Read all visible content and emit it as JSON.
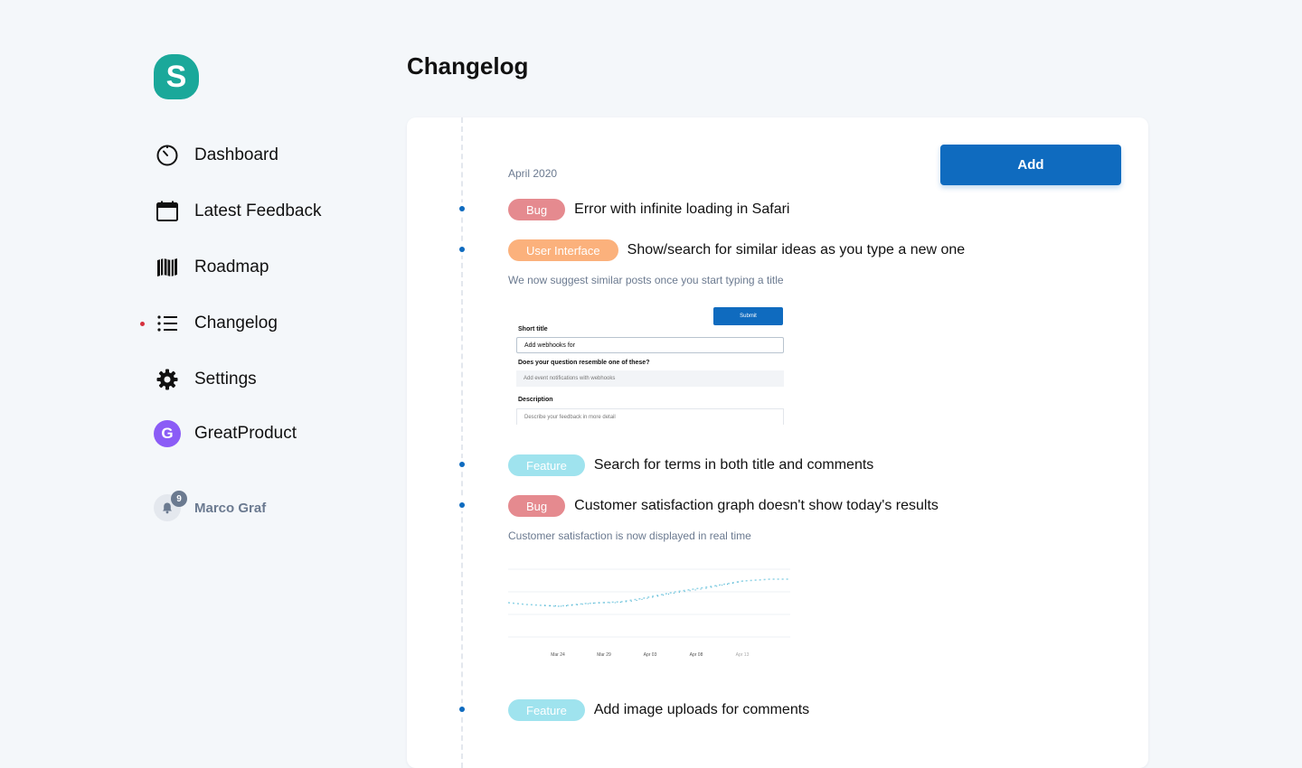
{
  "sidebar": {
    "logo_letter": "S",
    "items": [
      {
        "label": "Dashboard",
        "icon": "timer-icon"
      },
      {
        "label": "Latest Feedback",
        "icon": "calendar-icon"
      },
      {
        "label": "Roadmap",
        "icon": "map-icon"
      },
      {
        "label": "Changelog",
        "icon": "list-icon",
        "active": true
      },
      {
        "label": "Settings",
        "icon": "gear-icon"
      }
    ],
    "product": {
      "label": "GreatProduct",
      "initial": "G",
      "color": "#8b5cf6"
    },
    "user": {
      "name": "Marco Graf",
      "notifications": "9"
    }
  },
  "main": {
    "title": "Changelog",
    "add_label": "Add",
    "month": "April 2020",
    "entries": [
      {
        "tag": "Bug",
        "title": "Error with infinite loading in Safari"
      },
      {
        "tag": "User Interface",
        "title": "Show/search for similar ideas as you type a new one",
        "description": "We now suggest similar posts once you start typing a title"
      },
      {
        "tag": "Feature",
        "title": "Search for terms in both title and comments"
      },
      {
        "tag": "Bug",
        "title": "Customer satisfaction graph doesn't show today's results",
        "description": "Customer satisfaction is now displayed in real time"
      },
      {
        "tag": "Feature",
        "title": "Add image uploads for comments"
      }
    ],
    "preview_form": {
      "submit": "Submit",
      "short_title_label": "Short title",
      "short_title_value": "Add webhooks for",
      "resemble_label": "Does your question resemble one of these?",
      "suggestion": "Add event notifications with webhooks",
      "description_label": "Description",
      "description_placeholder": "Describe your feedback in more detail"
    },
    "preview_chart": {
      "x_labels": [
        "Mar 24",
        "Mar 29",
        "Apr 03",
        "Apr 08",
        "Apr 13"
      ]
    }
  },
  "colors": {
    "accent": "#0f6bbf",
    "logo": "#1aa89a",
    "bug": "#e58a8f",
    "ui": "#fbb17c",
    "feature": "#9fe3ee",
    "active_dot": "#d6313e"
  }
}
